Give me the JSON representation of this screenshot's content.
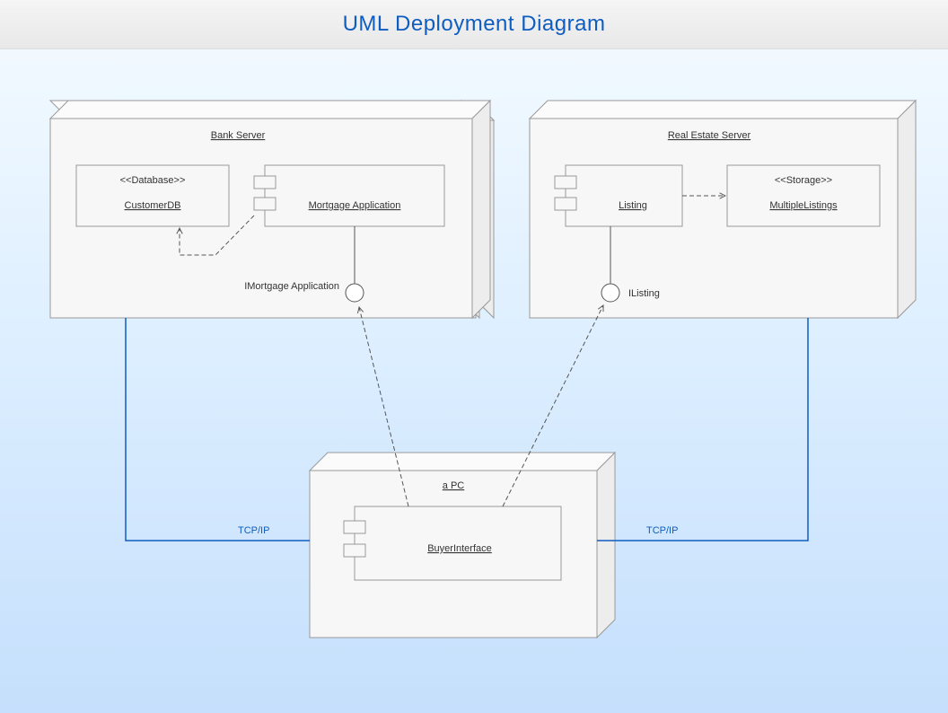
{
  "title": "UML Deployment Diagram",
  "nodes": {
    "bank": {
      "name": "Bank Server",
      "components": {
        "db": {
          "stereotype": "<<Database>>",
          "name": "CustomerDB"
        },
        "app": {
          "name": "Mortgage Application"
        }
      },
      "interface": "IMortgage Application"
    },
    "realestate": {
      "name": "Real Estate Server",
      "components": {
        "listing": {
          "name": "Listing"
        },
        "storage": {
          "stereotype": "<<Storage>>",
          "name": "MultipleListings"
        }
      },
      "interface": "IListing"
    },
    "pc": {
      "name": "a PC",
      "components": {
        "buyer": {
          "name": "BuyerInterface"
        }
      }
    }
  },
  "connections": {
    "left": "TCP/IP",
    "right": "TCP/IP"
  }
}
